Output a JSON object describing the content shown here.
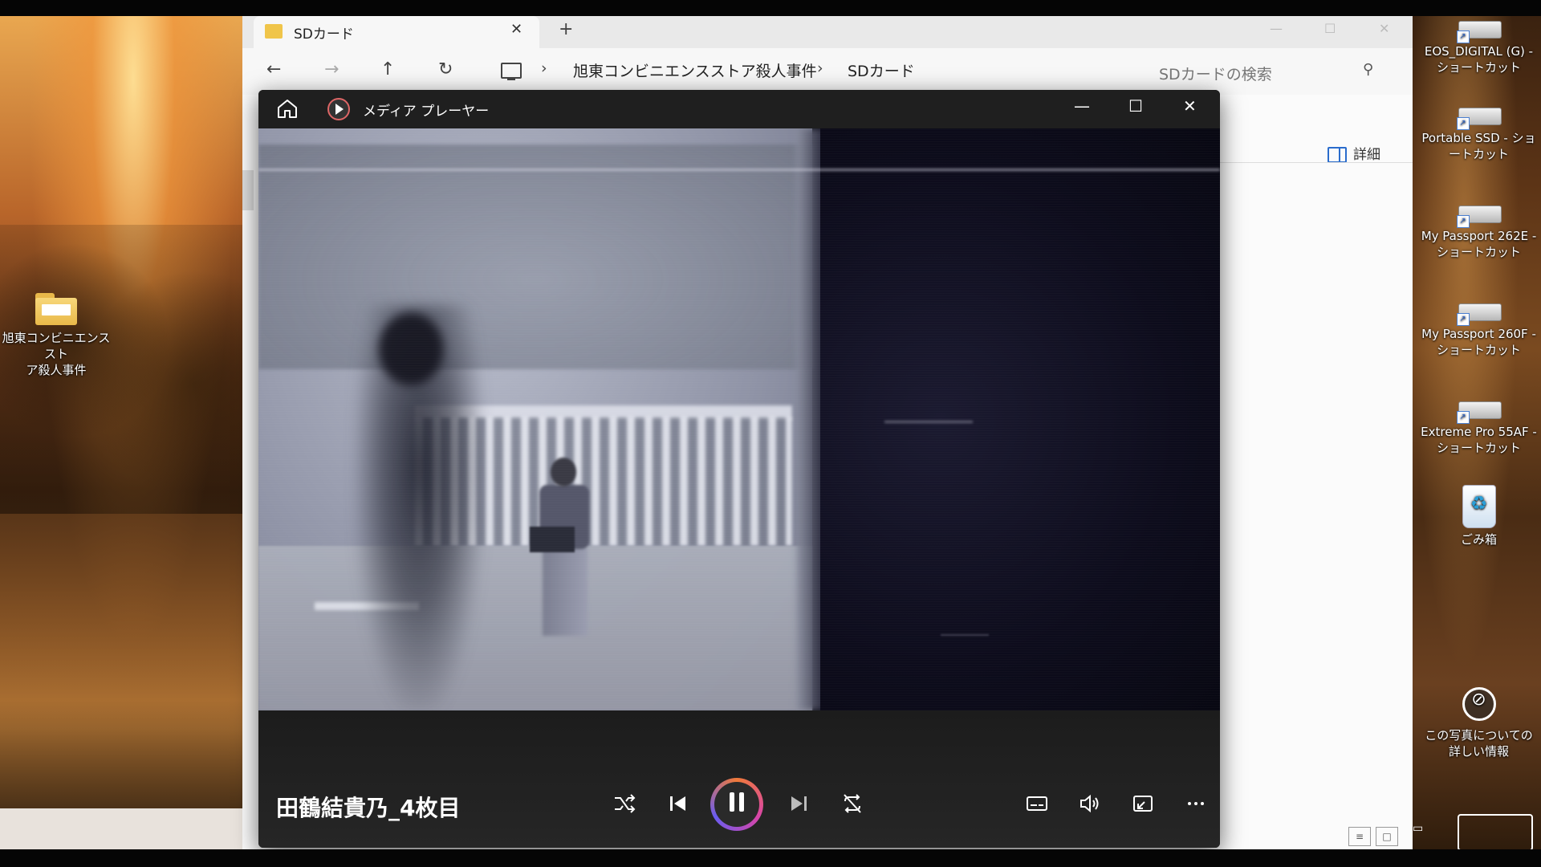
{
  "desktop": {
    "left_icon_label_line1": "旭東コンビニエンススト",
    "left_icon_label_line2": "ア殺人事件",
    "right_icons": [
      {
        "line1": "EOS_DIGITAL (G) -",
        "line2": "ショートカット",
        "icon": "drive-shortcut-icon"
      },
      {
        "line1": "Portable SSD - ショ",
        "line2": "ートカット",
        "icon": "drive-shortcut-icon"
      },
      {
        "line1": "My Passport 262E -",
        "line2": "ショートカット",
        "icon": "drive-shortcut-icon"
      },
      {
        "line1": "My Passport 260F -",
        "line2": "ショートカット",
        "icon": "drive-shortcut-icon"
      },
      {
        "line1": "Extreme Pro 55AF -",
        "line2": "ショートカット",
        "icon": "drive-shortcut-icon"
      },
      {
        "line1": "ごみ箱",
        "line2": "",
        "icon": "recycle-bin-icon"
      },
      {
        "line1": "この写真についての",
        "line2": "詳しい情報",
        "icon": "photo-info-icon"
      }
    ]
  },
  "explorer": {
    "tab_title": "SDカード",
    "breadcrumb": [
      "旭東コンビニエンスストア殺人事件",
      "SDカード"
    ],
    "search_placeholder": "SDカードの検索",
    "details_label": "詳細"
  },
  "player": {
    "app_title": "メディア プレーヤー",
    "now_playing": "田鶴結貴乃_4枚目",
    "state": "playing"
  },
  "colors": {
    "player_bg": "#202020",
    "accent_ring": [
      "#f07a3a",
      "#d845a8",
      "#6a5cf0"
    ],
    "explorer_bg": "#f3f3f3"
  }
}
